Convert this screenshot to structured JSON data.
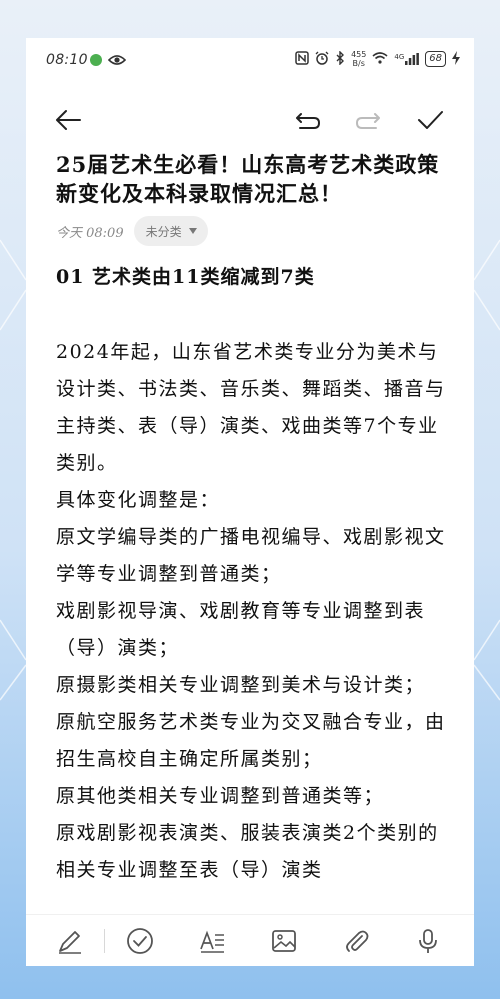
{
  "status_bar": {
    "time": "08:10",
    "network_speed_value": "455",
    "network_speed_unit": "B/s",
    "cell_label": "4G",
    "battery": "68"
  },
  "toolbar": {
    "back_icon": "back-arrow-icon",
    "undo_icon": "undo-icon",
    "redo_icon": "redo-icon",
    "done_icon": "check-icon"
  },
  "note": {
    "title": "25届艺术生必看！山东高考艺术类政策新变化及本科录取情况汇总！",
    "date": "今天 08:09",
    "category": "未分类",
    "heading": "01  艺术类由11类缩减到7类",
    "paragraphs": [
      "2024年起，山东省艺术类专业分为美术与设计类、书法类、音乐类、舞蹈类、播音与主持类、表（导）演类、戏曲类等7个专业类别。",
      " 具体变化调整是：",
      "原文学编导类的广播电视编导、戏剧影视文学等专业调整到普通类；",
      "戏剧影视导演、戏剧教育等专业调整到表（导）演类；",
      "原摄影类相关专业调整到美术与设计类；",
      "原航空服务艺术类专业为交叉融合专业，由招生高校自主确定所属类别；",
      "原其他类相关专业调整到普通类等；",
      "原戏剧影视表演类、服装表演类2个类别的相关专业调整至表（导）演类"
    ]
  },
  "bottom_tools": [
    "pen-icon",
    "checklist-icon",
    "text-format-icon",
    "image-icon",
    "attachment-icon",
    "microphone-icon"
  ],
  "colors": {
    "accent_bg": "#8fc0ee",
    "check_badge": "#4caf50",
    "text": "#111111",
    "muted": "#8a8a8a"
  }
}
